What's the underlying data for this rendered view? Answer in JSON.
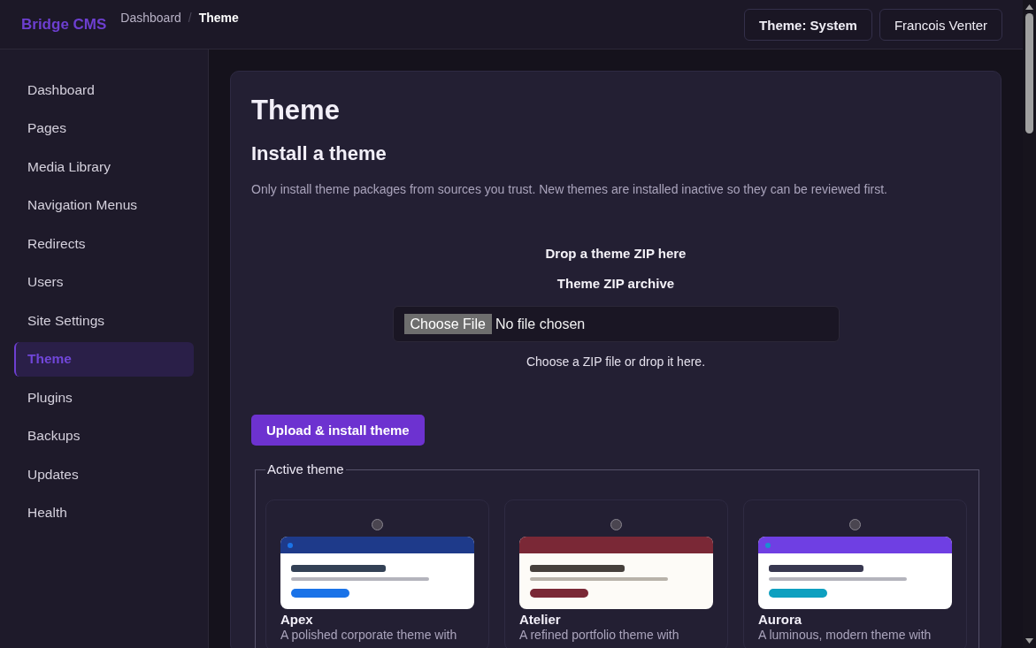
{
  "app": {
    "brand": "Bridge CMS"
  },
  "breadcrumb": {
    "separator": "/",
    "items": [
      {
        "label": "Dashboard",
        "current": false
      },
      {
        "label": "Theme",
        "current": true
      }
    ]
  },
  "header_actions": {
    "theme_button": "Theme: System",
    "user_button": "Francois Venter"
  },
  "sidebar": {
    "items": [
      {
        "label": "Dashboard",
        "selected": false
      },
      {
        "label": "Pages",
        "selected": false
      },
      {
        "label": "Media Library",
        "selected": false
      },
      {
        "label": "Navigation Menus",
        "selected": false
      },
      {
        "label": "Redirects",
        "selected": false
      },
      {
        "label": "Users",
        "selected": false
      },
      {
        "label": "Site Settings",
        "selected": false
      },
      {
        "label": "Theme",
        "selected": true
      },
      {
        "label": "Plugins",
        "selected": false
      },
      {
        "label": "Backups",
        "selected": false
      },
      {
        "label": "Updates",
        "selected": false
      },
      {
        "label": "Health",
        "selected": false
      }
    ]
  },
  "page": {
    "title": "Theme",
    "section_title": "Install a theme",
    "notice": "Only install theme packages from sources you trust. New themes are installed inactive so they can be reviewed first."
  },
  "upload": {
    "dropzone_title": "Drop a theme ZIP here",
    "field_label": "Theme ZIP archive",
    "file_button": "Choose File",
    "file_status": "No file chosen",
    "hint": "Choose a ZIP file or drop it here.",
    "submit": "Upload & install theme"
  },
  "active_theme": {
    "legend": "Active theme",
    "themes": [
      {
        "name": "Apex",
        "description": "A polished corporate theme with",
        "selected": false,
        "preview": [
          {
            "kind": "surface",
            "color": "#ffffff"
          },
          {
            "kind": "header",
            "color": "#1e3a8a"
          },
          {
            "kind": "dot",
            "color": "#1a73e8"
          },
          {
            "kind": "title",
            "color": "#334155"
          },
          {
            "kind": "line",
            "color": "#b4b4bc"
          },
          {
            "kind": "pill",
            "color": "#1a73e8"
          }
        ]
      },
      {
        "name": "Atelier",
        "description": "A refined portfolio theme with",
        "selected": false,
        "preview": [
          {
            "kind": "surface",
            "color": "#fdfbf7"
          },
          {
            "kind": "header",
            "color": "#7a2836"
          },
          {
            "kind": "title",
            "color": "#46403c"
          },
          {
            "kind": "line",
            "color": "#b8b2aa"
          },
          {
            "kind": "pill",
            "color": "#7a2836"
          }
        ]
      },
      {
        "name": "Aurora",
        "description": "A luminous, modern theme with",
        "selected": false,
        "preview": [
          {
            "kind": "surface",
            "color": "#ffffff"
          },
          {
            "kind": "header",
            "color": "#6f3fe3"
          },
          {
            "kind": "dot",
            "color": "#1a8fd0"
          },
          {
            "kind": "title",
            "color": "#383850"
          },
          {
            "kind": "line",
            "color": "#b4b4bc"
          },
          {
            "kind": "pill",
            "color": "#0ea0c0"
          }
        ]
      }
    ]
  }
}
